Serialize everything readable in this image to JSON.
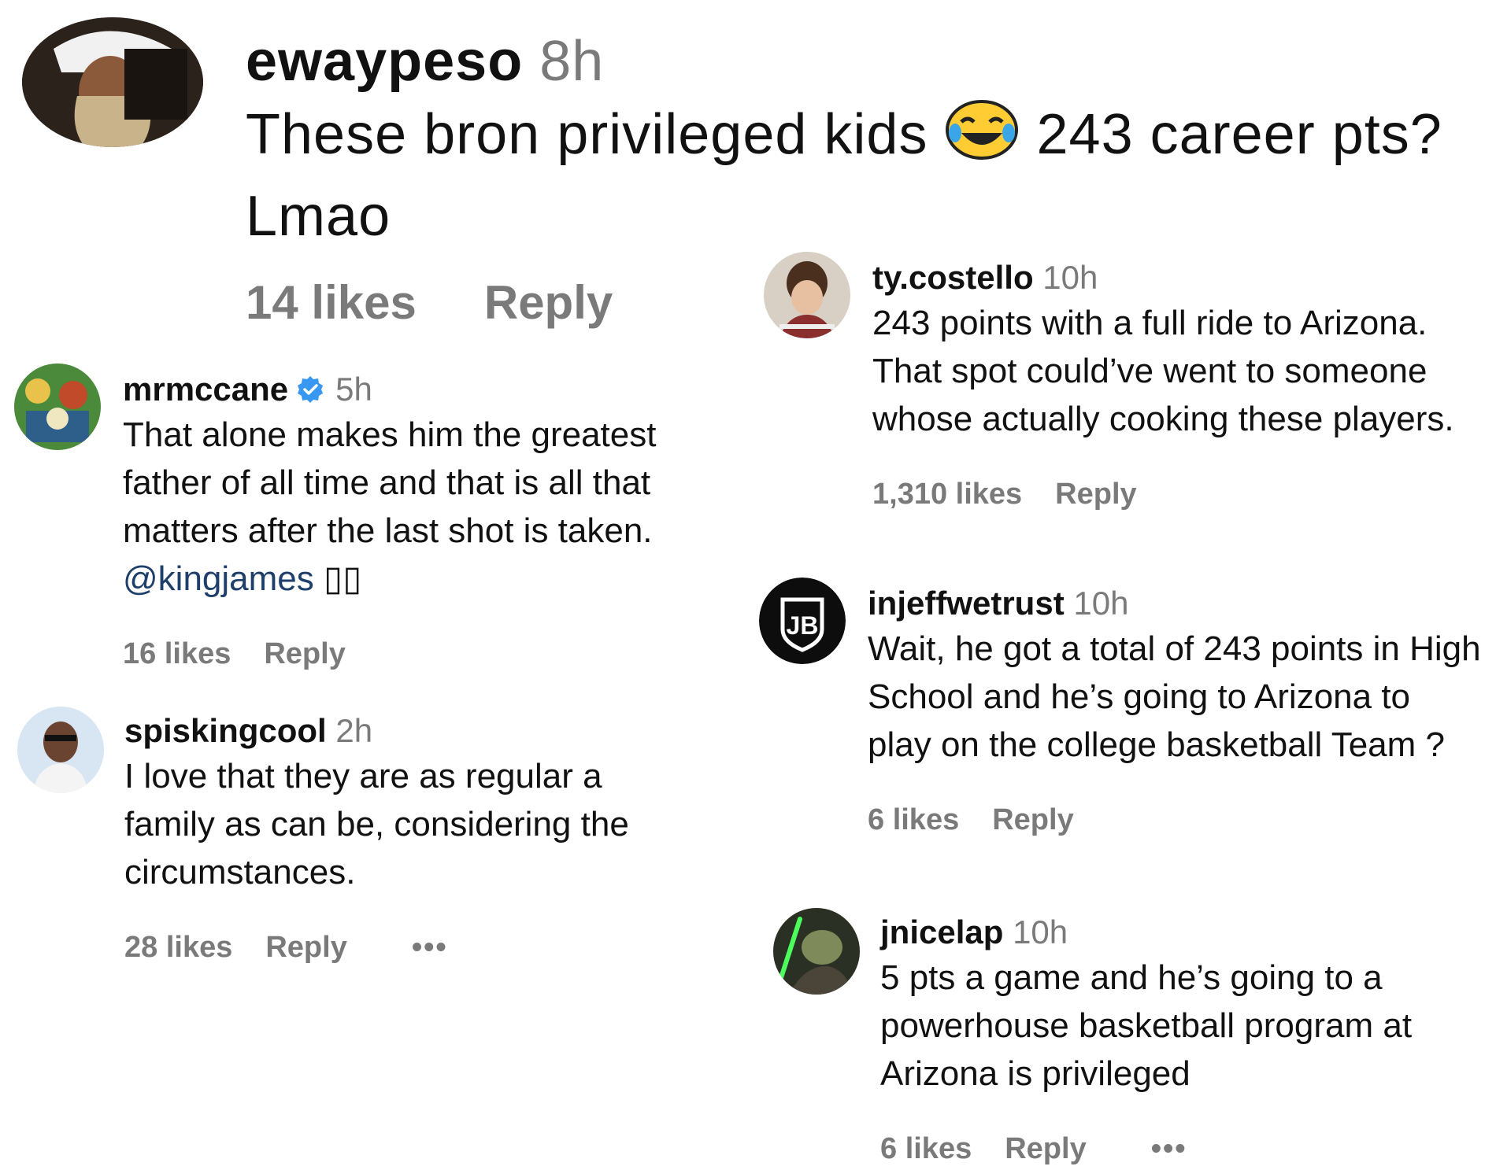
{
  "comments": {
    "top": {
      "username": "ewaypeso",
      "time": "8h",
      "text": "These bron privileged kids",
      "text_after_emoji": "243 career pts? Lmao",
      "likes": "14 likes",
      "reply": "Reply"
    },
    "mrmccane": {
      "username": "mrmccane",
      "time": "5h",
      "text": "That alone makes him the greatest father of all time and that is all that matters after the last shot is taken.",
      "mention": "@kingjames",
      "trailing": "▯▯",
      "likes": "16 likes",
      "reply": "Reply"
    },
    "spiskingcool": {
      "username": "spiskingcool",
      "time": "2h",
      "text": "I love that they are as regular a family as can be, considering the circumstances.",
      "likes": "28 likes",
      "reply": "Reply",
      "more": "•••"
    },
    "tycostello": {
      "username": "ty.costello",
      "time": "10h",
      "text": "243 points with a full ride to Arizona. That spot could’ve went to someone whose actually cooking these players.",
      "likes": "1,310 likes",
      "reply": "Reply"
    },
    "injeffwetrust": {
      "username": "injeffwetrust",
      "time": "10h",
      "text": "Wait, he got a total of 243 points in High School and he’s going to Arizona to play on the college basketball Team ?",
      "likes": "6 likes",
      "reply": "Reply"
    },
    "jnicelap": {
      "username": "jnicelap",
      "time": "10h",
      "text": "5 pts a game and he’s going to a powerhouse basketball program at Arizona is privileged",
      "likes": "6 likes",
      "reply": "Reply",
      "more": "•••"
    }
  },
  "avatars": {
    "jb_logo_text": "JB"
  },
  "colors": {
    "verified": "#3897f0",
    "muted": "#7a7a7a",
    "mention": "#1f3f6b"
  }
}
